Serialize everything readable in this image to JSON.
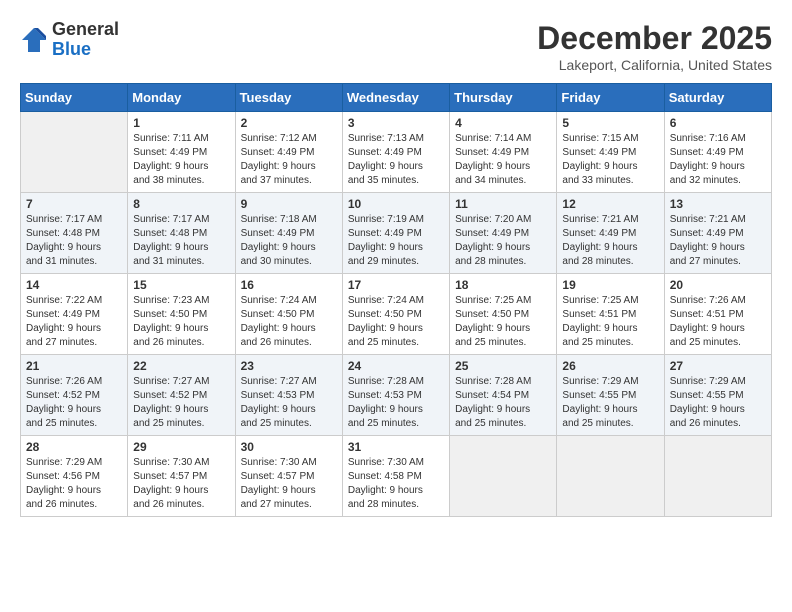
{
  "logo": {
    "general": "General",
    "blue": "Blue"
  },
  "header": {
    "month": "December 2025",
    "location": "Lakeport, California, United States"
  },
  "weekdays": [
    "Sunday",
    "Monday",
    "Tuesday",
    "Wednesday",
    "Thursday",
    "Friday",
    "Saturday"
  ],
  "weeks": [
    [
      {
        "day": "",
        "info": ""
      },
      {
        "day": "1",
        "info": "Sunrise: 7:11 AM\nSunset: 4:49 PM\nDaylight: 9 hours\nand 38 minutes."
      },
      {
        "day": "2",
        "info": "Sunrise: 7:12 AM\nSunset: 4:49 PM\nDaylight: 9 hours\nand 37 minutes."
      },
      {
        "day": "3",
        "info": "Sunrise: 7:13 AM\nSunset: 4:49 PM\nDaylight: 9 hours\nand 35 minutes."
      },
      {
        "day": "4",
        "info": "Sunrise: 7:14 AM\nSunset: 4:49 PM\nDaylight: 9 hours\nand 34 minutes."
      },
      {
        "day": "5",
        "info": "Sunrise: 7:15 AM\nSunset: 4:49 PM\nDaylight: 9 hours\nand 33 minutes."
      },
      {
        "day": "6",
        "info": "Sunrise: 7:16 AM\nSunset: 4:49 PM\nDaylight: 9 hours\nand 32 minutes."
      }
    ],
    [
      {
        "day": "7",
        "info": "Sunrise: 7:17 AM\nSunset: 4:48 PM\nDaylight: 9 hours\nand 31 minutes."
      },
      {
        "day": "8",
        "info": "Sunrise: 7:17 AM\nSunset: 4:48 PM\nDaylight: 9 hours\nand 31 minutes."
      },
      {
        "day": "9",
        "info": "Sunrise: 7:18 AM\nSunset: 4:49 PM\nDaylight: 9 hours\nand 30 minutes."
      },
      {
        "day": "10",
        "info": "Sunrise: 7:19 AM\nSunset: 4:49 PM\nDaylight: 9 hours\nand 29 minutes."
      },
      {
        "day": "11",
        "info": "Sunrise: 7:20 AM\nSunset: 4:49 PM\nDaylight: 9 hours\nand 28 minutes."
      },
      {
        "day": "12",
        "info": "Sunrise: 7:21 AM\nSunset: 4:49 PM\nDaylight: 9 hours\nand 28 minutes."
      },
      {
        "day": "13",
        "info": "Sunrise: 7:21 AM\nSunset: 4:49 PM\nDaylight: 9 hours\nand 27 minutes."
      }
    ],
    [
      {
        "day": "14",
        "info": "Sunrise: 7:22 AM\nSunset: 4:49 PM\nDaylight: 9 hours\nand 27 minutes."
      },
      {
        "day": "15",
        "info": "Sunrise: 7:23 AM\nSunset: 4:50 PM\nDaylight: 9 hours\nand 26 minutes."
      },
      {
        "day": "16",
        "info": "Sunrise: 7:24 AM\nSunset: 4:50 PM\nDaylight: 9 hours\nand 26 minutes."
      },
      {
        "day": "17",
        "info": "Sunrise: 7:24 AM\nSunset: 4:50 PM\nDaylight: 9 hours\nand 25 minutes."
      },
      {
        "day": "18",
        "info": "Sunrise: 7:25 AM\nSunset: 4:50 PM\nDaylight: 9 hours\nand 25 minutes."
      },
      {
        "day": "19",
        "info": "Sunrise: 7:25 AM\nSunset: 4:51 PM\nDaylight: 9 hours\nand 25 minutes."
      },
      {
        "day": "20",
        "info": "Sunrise: 7:26 AM\nSunset: 4:51 PM\nDaylight: 9 hours\nand 25 minutes."
      }
    ],
    [
      {
        "day": "21",
        "info": "Sunrise: 7:26 AM\nSunset: 4:52 PM\nDaylight: 9 hours\nand 25 minutes."
      },
      {
        "day": "22",
        "info": "Sunrise: 7:27 AM\nSunset: 4:52 PM\nDaylight: 9 hours\nand 25 minutes."
      },
      {
        "day": "23",
        "info": "Sunrise: 7:27 AM\nSunset: 4:53 PM\nDaylight: 9 hours\nand 25 minutes."
      },
      {
        "day": "24",
        "info": "Sunrise: 7:28 AM\nSunset: 4:53 PM\nDaylight: 9 hours\nand 25 minutes."
      },
      {
        "day": "25",
        "info": "Sunrise: 7:28 AM\nSunset: 4:54 PM\nDaylight: 9 hours\nand 25 minutes."
      },
      {
        "day": "26",
        "info": "Sunrise: 7:29 AM\nSunset: 4:55 PM\nDaylight: 9 hours\nand 25 minutes."
      },
      {
        "day": "27",
        "info": "Sunrise: 7:29 AM\nSunset: 4:55 PM\nDaylight: 9 hours\nand 26 minutes."
      }
    ],
    [
      {
        "day": "28",
        "info": "Sunrise: 7:29 AM\nSunset: 4:56 PM\nDaylight: 9 hours\nand 26 minutes."
      },
      {
        "day": "29",
        "info": "Sunrise: 7:30 AM\nSunset: 4:57 PM\nDaylight: 9 hours\nand 26 minutes."
      },
      {
        "day": "30",
        "info": "Sunrise: 7:30 AM\nSunset: 4:57 PM\nDaylight: 9 hours\nand 27 minutes."
      },
      {
        "day": "31",
        "info": "Sunrise: 7:30 AM\nSunset: 4:58 PM\nDaylight: 9 hours\nand 28 minutes."
      },
      {
        "day": "",
        "info": ""
      },
      {
        "day": "",
        "info": ""
      },
      {
        "day": "",
        "info": ""
      }
    ]
  ]
}
